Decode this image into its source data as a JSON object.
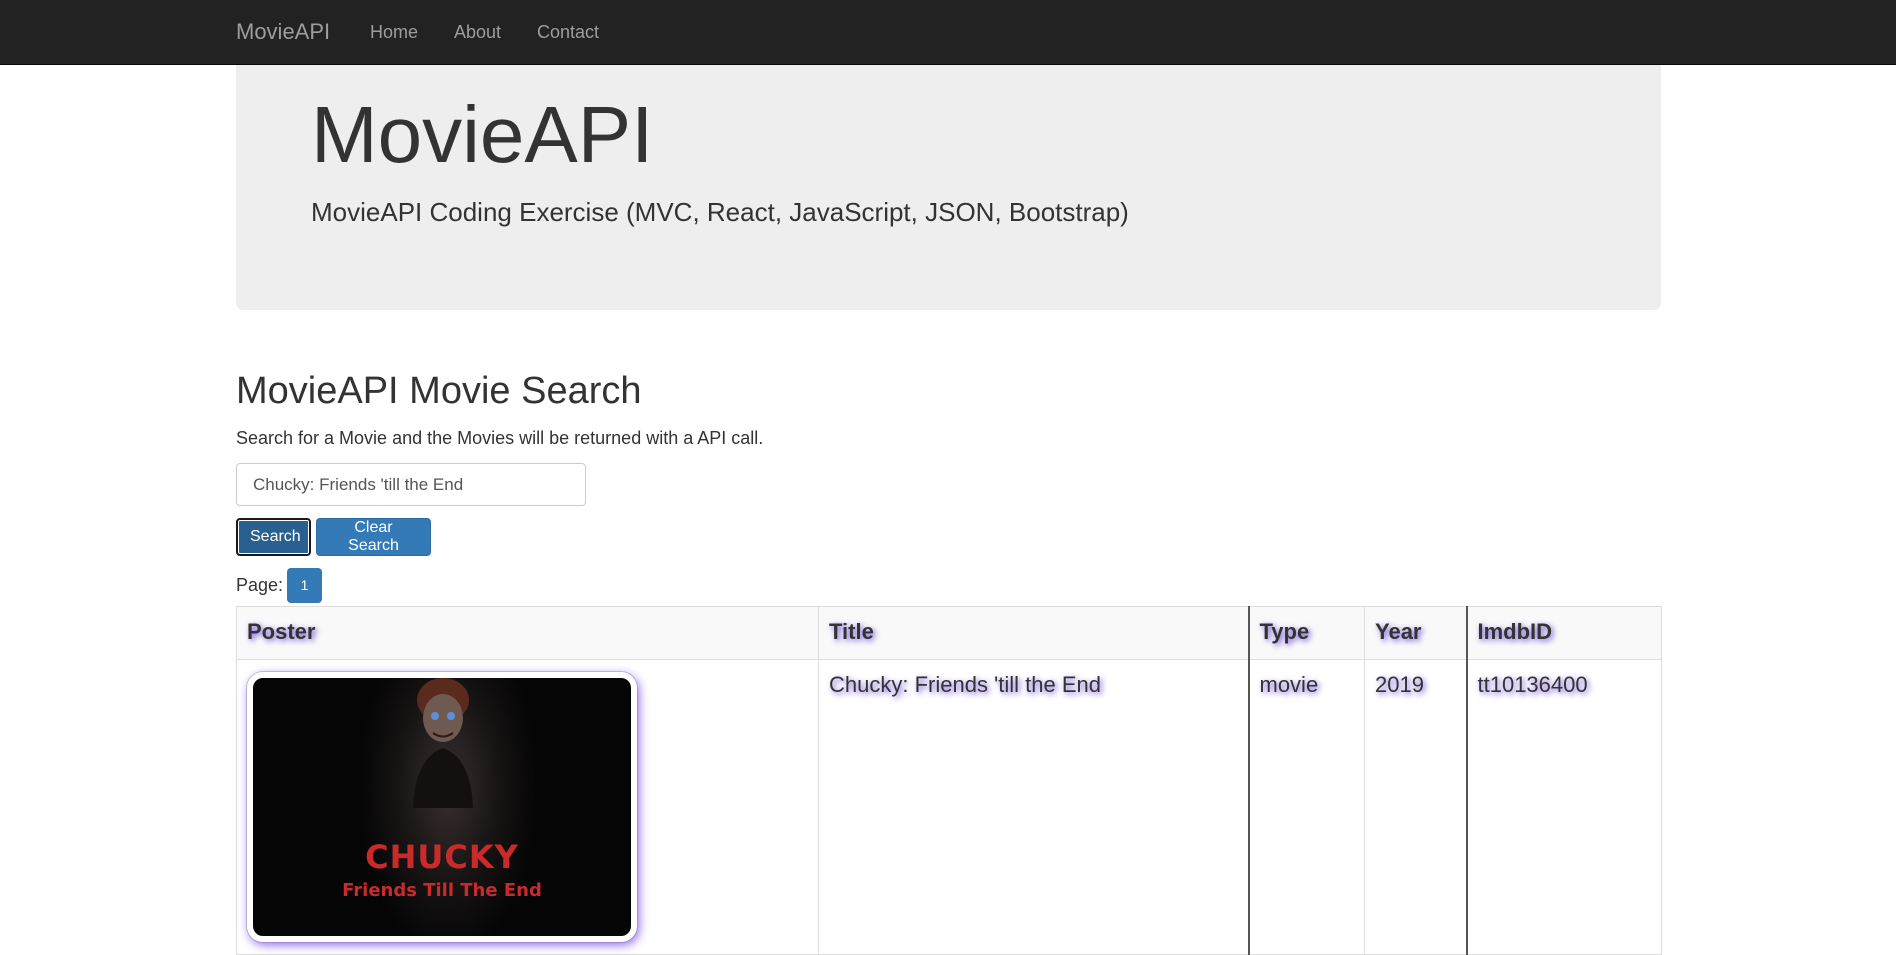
{
  "navbar": {
    "brand": "MovieAPI",
    "links": [
      "Home",
      "About",
      "Contact"
    ]
  },
  "jumbotron": {
    "title": "MovieAPI",
    "lead": "MovieAPI Coding Exercise (MVC, React, JavaScript, JSON, Bootstrap)"
  },
  "search": {
    "heading": "MovieAPI Movie Search",
    "description": "Search for a Movie and the Movies will be returned with a API call.",
    "input_value": "Chucky: Friends 'till the End",
    "search_label": "Search",
    "clear_label": "Clear Search"
  },
  "pagination": {
    "label": "Page:",
    "current": "1"
  },
  "table": {
    "headers": [
      "Poster",
      "Title",
      "Type",
      "Year",
      "ImdbID"
    ],
    "rows": [
      {
        "poster_text": "CHUCKY",
        "poster_subtext": "Friends Till The End",
        "title": "Chucky: Friends 'till the End",
        "type": "movie",
        "year": "2019",
        "imdbid": "tt10136400"
      }
    ]
  },
  "colors": {
    "navbar_bg": "#222222",
    "jumbotron_bg": "#eeeeee",
    "primary": "#337ab7",
    "text_shadow": "#6f4fd6"
  }
}
